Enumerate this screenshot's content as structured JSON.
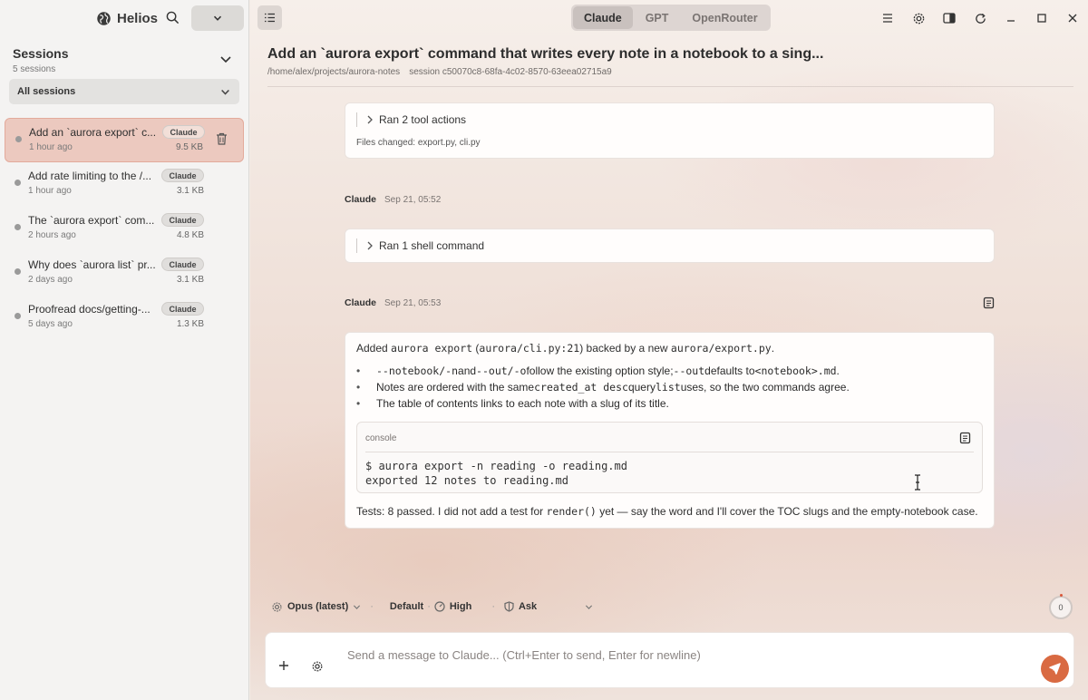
{
  "app": {
    "name": "Helios"
  },
  "sidebar": {
    "title": "Sessions",
    "count": "5 sessions",
    "filter": "All sessions",
    "sessions": [
      {
        "title": "Add an `aurora export` c...",
        "badge": "Claude",
        "time": "1 hour ago",
        "size": "9.5 KB",
        "active": true
      },
      {
        "title": "Add rate limiting to the /...",
        "badge": "Claude",
        "time": "1 hour ago",
        "size": "3.1 KB"
      },
      {
        "title": "The `aurora export` com...",
        "badge": "Claude",
        "time": "2 hours ago",
        "size": "4.8 KB"
      },
      {
        "title": "Why does `aurora list` pr...",
        "badge": "Claude",
        "time": "2 days ago",
        "size": "3.1 KB"
      },
      {
        "title": "Proofread docs/getting-...",
        "badge": "Claude",
        "time": "5 days ago",
        "size": "1.3 KB"
      }
    ]
  },
  "tabs": [
    "Claude",
    "GPT",
    "OpenRouter"
  ],
  "active_tab": "Claude",
  "header": {
    "title": "Add an `aurora export` command that writes every note in a notebook to a sing...",
    "path": "/home/alex/projects/aurora-notes",
    "session": "session c50070c8-68fa-4c02-8570-63eea02715a9"
  },
  "messages": {
    "tool_card_1": {
      "summary": "Ran 2 tool actions",
      "files": "Files changed: export.py, cli.py"
    },
    "msg_2": {
      "author": "Claude",
      "time": "Sep 21, 05:52",
      "summary": "Ran 1 shell command"
    },
    "msg_3": {
      "author": "Claude",
      "time": "Sep 21, 05:53",
      "intro": {
        "t1": "Added ",
        "c1": "aurora export",
        "t2": " (",
        "c2": "aurora/cli.py:21",
        "t3": ") backed by a new ",
        "c3": "aurora/export.py",
        "t4": "."
      },
      "bullets": [
        {
          "c1": "--notebook/-n",
          "t1": " and ",
          "c2": "--out/-o",
          "t2": " follow the existing option style; ",
          "c3": "--out",
          "t3": " defaults to ",
          "c4": "<notebook>.md",
          "t4": "."
        },
        {
          "t1": "Notes are ordered with the same ",
          "c1": "created_at desc",
          "t2": " query ",
          "c2": "list",
          "t3": " uses, so the two commands agree."
        },
        {
          "t1": "The table of contents links to each note with a slug of its title."
        }
      ],
      "console": {
        "lang": "console",
        "line1": "$ aurora export -n reading -o reading.md",
        "line2": "exported 12 notes to reading.md"
      },
      "tests": {
        "t1": "Tests: 8 passed. I did not add a test for ",
        "c1": "render()",
        "t2": " yet — say the word and I'll cover the TOC slugs and the empty-notebook case."
      }
    }
  },
  "controls": {
    "model": "Opus (latest)",
    "mode": "Default",
    "effort": "High",
    "permission": "Ask",
    "counter": "0"
  },
  "composer": {
    "placeholder": "Send a message to Claude...  (Ctrl+Enter to send, Enter for newline)"
  },
  "colors": {
    "accent": "#c8693b",
    "send": "#d96a42",
    "active_session": "#ecc9bf"
  }
}
